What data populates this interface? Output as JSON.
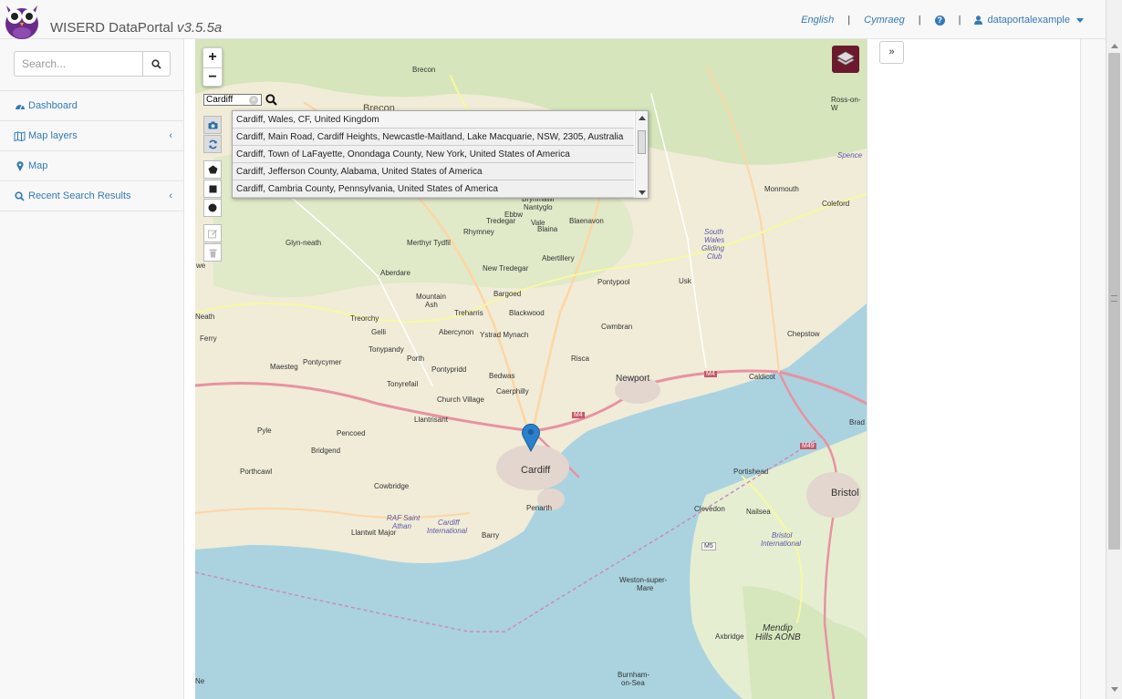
{
  "header": {
    "brand": "WISERD DataPortal",
    "version": "v3.5.5a",
    "lang_en": "English",
    "lang_cy": "Cymraeg",
    "separator": "|",
    "username": "dataportalexample"
  },
  "sidebar": {
    "search_placeholder": "Search...",
    "items": [
      {
        "label": "Dashboard",
        "icon": "tachometer-icon"
      },
      {
        "label": "Map layers",
        "icon": "map-icon",
        "chevron": "‹"
      },
      {
        "label": "Map",
        "icon": "map-marker-icon"
      },
      {
        "label": "Recent Search Results",
        "icon": "search-icon",
        "chevron": "‹"
      }
    ]
  },
  "map": {
    "zoom_in": "+",
    "zoom_out": "−",
    "geo_search_value": "Cardiff",
    "results": [
      "Cardiff, Wales, CF, United Kingdom",
      "Cardiff, Main Road, Cardiff Heights, Newcastle-Maitland, Lake Macquarie, NSW, 2305, Australia",
      "Cardiff, Town of LaFayette, Onondaga County, New York, United States of America",
      "Cardiff, Jefferson County, Alabama, United States of America",
      "Cardiff, Cambria County, Pennsylvania, United States of America"
    ],
    "labels": {
      "brecon": "Brecon",
      "brecon2": "Brecon",
      "ross": "Ross-on-W",
      "spence": "Spence",
      "brynmawr": "Brynmawr",
      "nantyglo": "Nantyglo",
      "ebbw": "Ebbw",
      "vale": "Vale",
      "blaenavon": "Blaenavon",
      "tredegar": "Tredegar",
      "rhymney": "Rhymney",
      "blaina": "Blaina",
      "monmouth": "Monmouth",
      "coleford": "Coleford",
      "glyn": "Glyn-neath",
      "merthyr": "Merthyr Tydfil",
      "abertillery": "Abertillery",
      "southwales": "South",
      "southwales2": "Wales",
      "southwales3": "Gliding",
      "southwales4": "Club",
      "aberdare": "Aberdare",
      "newtredegar": "New Tredegar",
      "pontypool": "Pontypool",
      "usk": "Usk",
      "mountain": "Mountain",
      "ash": "Ash",
      "bargoed": "Bargoed",
      "neath": "Neath",
      "treorchy": "Treorchy",
      "treharris": "Treharris",
      "blackwood": "Blackwood",
      "cwmbran": "Cwmbran",
      "chepstow": "Chepstow",
      "ferry": "Ferry",
      "gelli": "Gelli",
      "abercynon": "Abercynon",
      "ystrad": "Ystrad Mynach",
      "tonypandy": "Tonypandy",
      "porth": "Porth",
      "risca": "Risca",
      "maesteg": "Maesteg",
      "pontycymer": "Pontycymer",
      "pontypridd": "Pontypridd",
      "bedwas": "Bedwas",
      "newport": "Newport",
      "m4": "M4",
      "caldicot": "Caldicot",
      "tonyrefail": "Tonyrefail",
      "caerphilly": "Caerphilly",
      "churchvillage": "Church Village",
      "llantrisant": "Llantrisant",
      "m4b": "M4",
      "brad": "Brad",
      "pyle": "Pyle",
      "pencoed": "Pencoed",
      "bridgend": "Bridgend",
      "m49": "M49",
      "cardiff": "Cardiff",
      "portheawl": "Porthcawl",
      "portishead": "Portishead",
      "cowbridge": "Cowbridge",
      "bristol": "Bristol",
      "penarth": "Penarth",
      "clevedon": "Clevedon",
      "nailsea": "Nailsea",
      "raf": "RAF Saint",
      "athan": "Athan",
      "cardiffint": "Cardiff",
      "cardiffint2": "International",
      "bristolint": "Bristol",
      "bristolint2": "International",
      "llantwit": "Llantwit Major",
      "barry": "Barry",
      "m5": "M5",
      "weston": "Weston-super-",
      "mare": "Mare",
      "axbridge": "Axbridge",
      "mendip": "Mendip",
      "mendip2": "Hills AONB",
      "burnham": "Burnham-",
      "onsea": "on-Sea",
      "we": "we",
      "ne": "Ne"
    }
  },
  "right_panel": {
    "collapse_label": "»"
  }
}
